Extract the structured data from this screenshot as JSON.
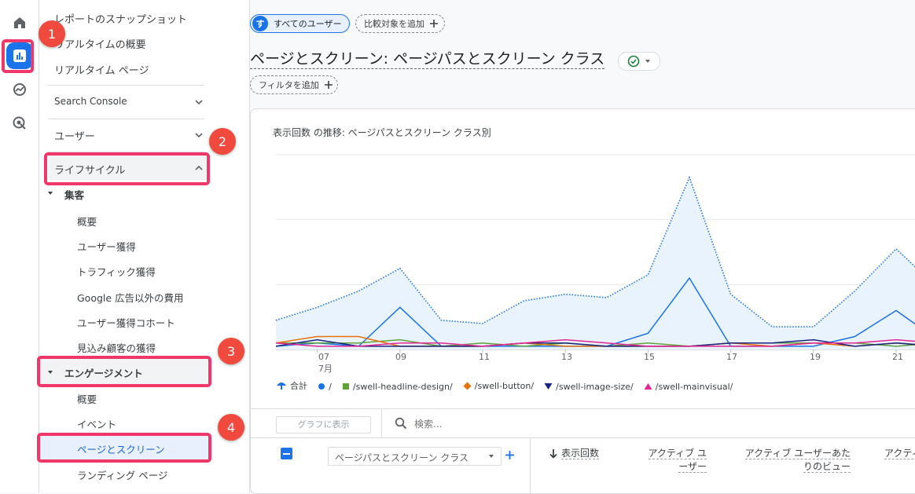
{
  "rail": {
    "icons": [
      "home-icon",
      "reports-icon",
      "explore-icon",
      "advertising-icon"
    ]
  },
  "nav": {
    "snapshot": "レポートのスナップショット",
    "realtime_overview": "リアルタイムの概要",
    "realtime_page": "リアルタイム ページ",
    "search_console": "Search Console",
    "users": "ユーザー",
    "lifecycle": "ライフサイクル",
    "acquisition": "集客",
    "acq_items": [
      "概要",
      "ユーザー獲得",
      "トラフィック獲得",
      "Google 広告以外の費用",
      "ユーザー獲得コホート",
      "見込み顧客の獲得"
    ],
    "engagement": "エンゲージメント",
    "eng_items": [
      "概要",
      "イベント",
      "ページとスクリーン",
      "ランディング ページ"
    ]
  },
  "badges": [
    "1",
    "2",
    "3",
    "4"
  ],
  "header": {
    "segment_icon": "す",
    "segment": "すべてのユーザー",
    "add_comparison": "比較対象を追加",
    "title": "ページとスクリーン: ページパスとスクリーン クラス",
    "add_filter": "フィルタを追加"
  },
  "chart_data": {
    "type": "line",
    "title": "表示回数 の推移: ページパスとスクリーン クラス別",
    "x_tick_labels": [
      "07",
      "09",
      "11",
      "13",
      "15",
      "17",
      "19",
      "21"
    ],
    "x_month_label": "7月",
    "x": [
      "07-06",
      "07-07",
      "07-08",
      "07-09",
      "07-10",
      "07-11",
      "07-12",
      "07-13",
      "07-14",
      "07-15",
      "07-16",
      "07-17",
      "07-18",
      "07-19",
      "07-20",
      "07-21",
      "07-22"
    ],
    "series": [
      {
        "name": "合計",
        "color": "#1a73e8",
        "style": "dotted-area",
        "values": [
          9,
          13,
          18,
          25,
          9,
          8,
          15,
          17,
          16,
          23,
          53,
          17,
          7,
          7,
          18,
          31,
          19
        ]
      },
      {
        "name": "/",
        "color": "#1a73e8",
        "values": [
          1,
          2,
          1,
          13,
          1,
          1,
          1,
          1,
          1,
          5,
          22,
          1,
          1,
          1,
          4,
          12,
          3
        ]
      },
      {
        "name": "/swell-headline-design/",
        "color": "#5fa33a",
        "values": [
          2,
          2,
          2,
          3,
          1,
          2,
          1,
          2,
          1,
          2,
          1,
          2,
          2,
          2,
          2,
          1,
          2
        ]
      },
      {
        "name": "/swell-button/",
        "color": "#e8710a",
        "values": [
          2,
          4,
          4,
          1,
          1,
          1,
          2,
          1,
          1,
          1,
          1,
          2,
          1,
          2,
          1,
          2,
          1
        ]
      },
      {
        "name": "/swell-image-size/",
        "color": "#1a237e",
        "values": [
          1,
          3,
          1,
          1,
          1,
          1,
          2,
          2,
          1,
          1,
          1,
          2,
          2,
          3,
          1,
          2,
          1
        ]
      },
      {
        "name": "/swell-mainvisual/",
        "color": "#e52592",
        "values": [
          2,
          1,
          1,
          2,
          2,
          1,
          2,
          3,
          2,
          1,
          1,
          1,
          1,
          2,
          2,
          3,
          2
        ]
      }
    ],
    "ylim": [
      0,
      60
    ]
  },
  "table": {
    "show_chart_btn": "グラフに表示",
    "search_placeholder": "検索...",
    "dimension": "ページパスとスクリーン クラス",
    "col_views": "表示回数",
    "col_active_users_1": "アクティブ ユ",
    "col_active_users_2": "ーザー",
    "col_views_per_user_1": "アクティブ ユーザーあた",
    "col_views_per_user_2": "りのビュー",
    "col_next": "アクティ"
  }
}
